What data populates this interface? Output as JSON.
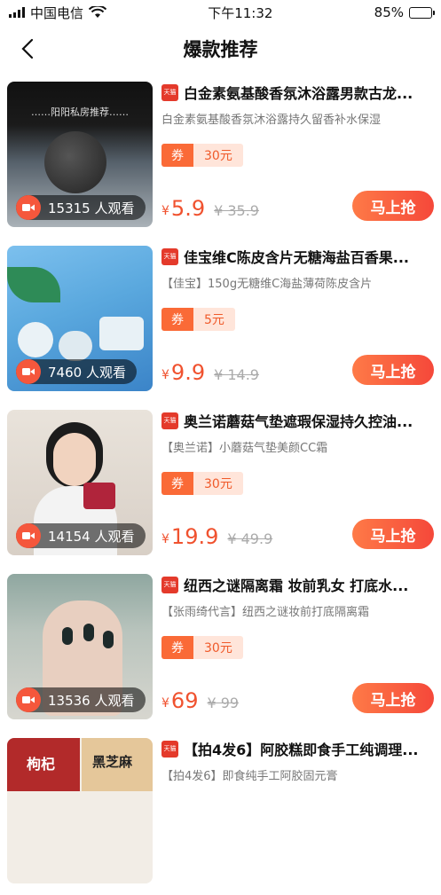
{
  "status": {
    "carrier": "中国电信",
    "time": "下午11:32",
    "battery": "85%",
    "battery_level": 0.85
  },
  "nav": {
    "title": "爆款推荐"
  },
  "labels": {
    "coupon": "券",
    "currency": "¥",
    "buy": "马上抢",
    "tmall": "天猫"
  },
  "products": [
    {
      "title": "白金素氨基酸香氛沐浴露男款古龙...",
      "subtitle": "白金素氨基酸香氛沐浴露持久留香补水保湿",
      "coupon": "30元",
      "price": "5.9",
      "original_price": "¥ 35.9",
      "viewers": "15315 人观看",
      "thumb_text": "……阳阳私房推荐……"
    },
    {
      "title": "佳宝维C陈皮含片无糖海盐百香果...",
      "subtitle": "【佳宝】150g无糖维C海盐薄荷陈皮含片",
      "coupon": "5元",
      "price": "9.9",
      "original_price": "¥ 14.9",
      "viewers": "7460 人观看"
    },
    {
      "title": "奥兰诺蘑菇气垫遮瑕保湿持久控油...",
      "subtitle": "【奥兰诺】小蘑菇气垫美颜CC霜",
      "coupon": "30元",
      "price": "19.9",
      "original_price": "¥ 49.9",
      "viewers": "14154 人观看"
    },
    {
      "title": "纽西之谜隔离霜 妆前乳女 打底水...",
      "subtitle": "【张雨绮代言】纽西之谜妆前打底隔离霜",
      "coupon": "30元",
      "price": "69",
      "original_price": "¥ 99",
      "viewers": "13536 人观看"
    },
    {
      "title": "【拍4发6】阿胶糕即食手工纯调理...",
      "subtitle": "【拍4发6】即食纯手工阿胶固元膏",
      "coupon": "",
      "price": "",
      "original_price": "",
      "viewers": "",
      "thumb_text_1": "枸杞",
      "thumb_text_2": "黑芝麻"
    }
  ],
  "colors": {
    "accent": "#f0522f",
    "coupon_bg": "#ffe5da",
    "tmall_red": "#e43a2b"
  }
}
